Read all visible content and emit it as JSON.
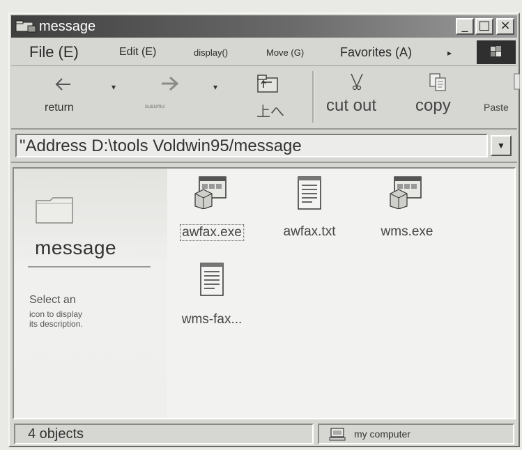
{
  "window": {
    "title": "message"
  },
  "menubar": {
    "items": [
      "File (E)",
      "Edit (E)",
      "display()",
      "Move (G)",
      "Favorites (A)"
    ],
    "more_arrow": "▸"
  },
  "toolbar": {
    "back_label": "return",
    "forward_label": "susumu",
    "up_label": "上へ",
    "cut_label": "cut out",
    "copy_label": "copy",
    "paste_label": "Paste",
    "dropdown_glyph": "▾"
  },
  "address": {
    "value": "\"Address D:\\tools Voldwin95/message"
  },
  "left_pane": {
    "folder_name": "message",
    "desc_line1": "Select an",
    "desc_line2": "icon to display",
    "desc_line3": "its description."
  },
  "files": [
    {
      "name": "awfax.exe",
      "icon": "application-exe-icon",
      "selected": true
    },
    {
      "name": "awfax.txt",
      "icon": "text-document-icon",
      "selected": false
    },
    {
      "name": "wms.exe",
      "icon": "application-exe-icon",
      "selected": false
    },
    {
      "name": "wms-fax...",
      "icon": "text-document-icon",
      "selected": false
    }
  ],
  "status": {
    "object_count": "4 objects",
    "zone": "my computer"
  }
}
